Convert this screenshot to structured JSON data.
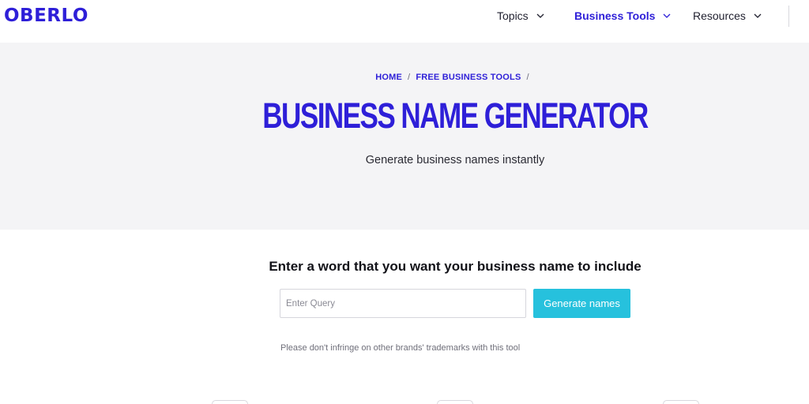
{
  "header": {
    "logo": "OBERLO",
    "nav": [
      {
        "label": "Topics",
        "active": false
      },
      {
        "label": "Business Tools",
        "active": true
      },
      {
        "label": "Resources",
        "active": false
      }
    ]
  },
  "hero": {
    "breadcrumb": [
      "HOME",
      "FREE BUSINESS TOOLS"
    ],
    "breadcrumb_separator": "/",
    "title": "BUSINESS NAME GENERATOR",
    "subtitle": "Generate business names instantly"
  },
  "form": {
    "heading": "Enter a word that you want your business name to include",
    "input_placeholder": "Enter Query",
    "input_value": "",
    "button_label": "Generate names",
    "disclaimer": "Please don't infringe on other brands' trademarks with this tool"
  },
  "colors": {
    "brand": "#2e1fd8",
    "button": "#26c1dd",
    "hero_bg": "#f4f4f6"
  },
  "icons": {
    "nav_chevron": "chevron-down-icon"
  }
}
